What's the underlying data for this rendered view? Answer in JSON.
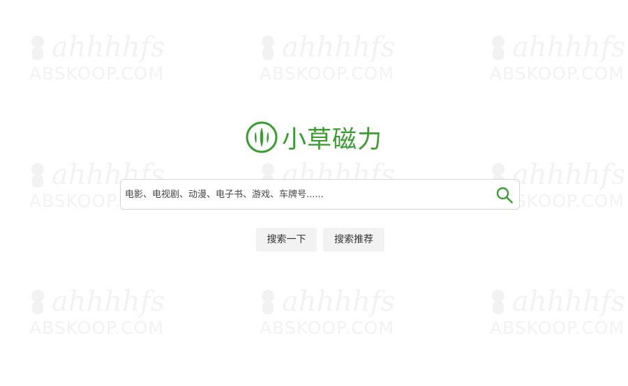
{
  "watermark": {
    "brand": "ahhhhfs",
    "domain": "ABSKOOP.COM"
  },
  "logo": {
    "icon": "grass-leaf-logo-icon",
    "title": "小草磁力",
    "brand_color": "#3b9c31"
  },
  "search": {
    "placeholder": "电影、电视剧、动漫、电子书、游戏、车牌号......",
    "value": "",
    "icon": "search-icon"
  },
  "buttons": {
    "search_label": "搜索一下",
    "recommend_label": "搜索推荐"
  },
  "colors": {
    "accent": "#3b9c31",
    "button_bg": "#f2f2f2",
    "border": "#d6d6d6"
  }
}
